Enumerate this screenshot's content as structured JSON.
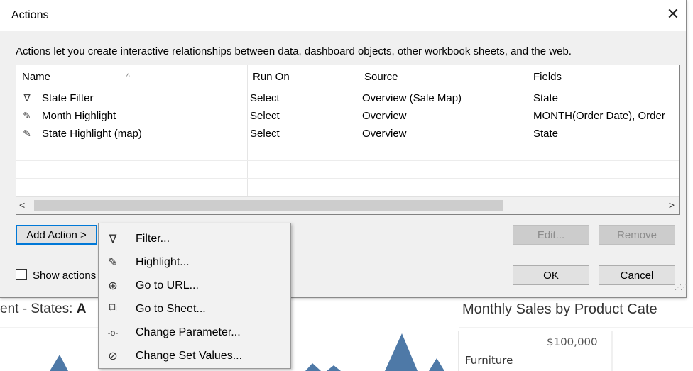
{
  "dialog": {
    "title": "Actions",
    "close_glyph": "✕",
    "description": "Actions let you create interactive relationships between data, dashboard objects, other workbook sheets, and the web."
  },
  "table": {
    "sort_indicator": "^",
    "columns": [
      "Name",
      "Run On",
      "Source",
      "Fields"
    ],
    "rows": [
      {
        "icon": "filter-icon",
        "glyph": "∇",
        "name": "State Filter",
        "run_on": "Select",
        "source": "Overview (Sale Map)",
        "fields": "State"
      },
      {
        "icon": "highlight-icon",
        "glyph": "✎",
        "name": "Month Highlight",
        "run_on": "Select",
        "source": "Overview",
        "fields": "MONTH(Order Date), Order"
      },
      {
        "icon": "highlight-icon",
        "glyph": "✎",
        "name": "State Highlight (map)",
        "run_on": "Select",
        "source": "Overview",
        "fields": "State"
      }
    ],
    "scroll_left": "<",
    "scroll_right": ">"
  },
  "buttons": {
    "add_action": "Add Action >",
    "edit": "Edit...",
    "remove": "Remove",
    "ok": "OK",
    "cancel": "Cancel"
  },
  "checkbox": {
    "label": "Show actions",
    "checked": false
  },
  "menu": {
    "items": [
      {
        "icon": "filter-icon",
        "glyph": "∇",
        "label": "Filter..."
      },
      {
        "icon": "highlight-icon",
        "glyph": "✎",
        "label": "Highlight..."
      },
      {
        "icon": "globe-icon",
        "glyph": "⊕",
        "label": "Go to URL..."
      },
      {
        "icon": "external-link-icon",
        "glyph": "⧉",
        "label": "Go to Sheet..."
      },
      {
        "icon": "parameter-icon",
        "glyph": "-o-",
        "label": "Change Parameter..."
      },
      {
        "icon": "set-values-icon",
        "glyph": "⊘",
        "label": "Change Set Values..."
      }
    ]
  },
  "background": {
    "left_title_prefix": "ent - States: ",
    "left_title_bold": "A",
    "right_title": "Monthly Sales by Product Cate",
    "axis_value": "$100,000",
    "category": "Furniture",
    "chart_color": "#4e79a7"
  }
}
